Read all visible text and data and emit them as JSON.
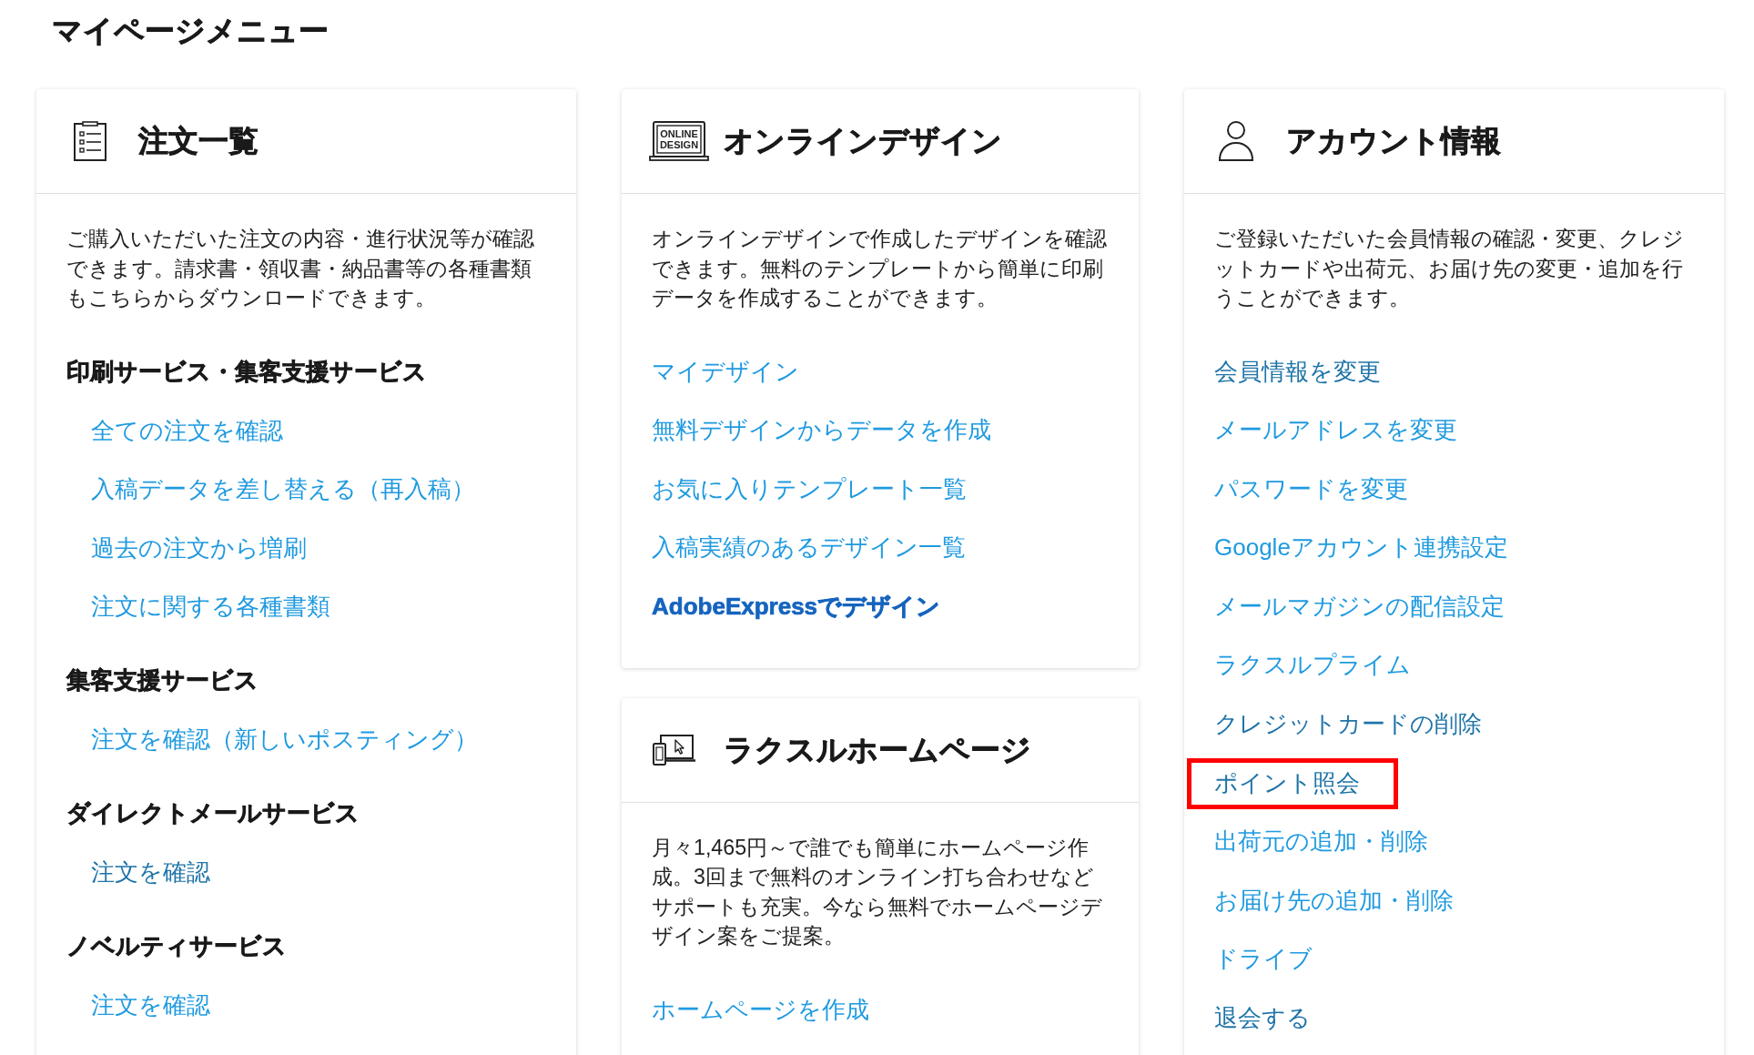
{
  "page_title": "マイページメニュー",
  "columns": [
    {
      "cards": [
        {
          "kind": "orders",
          "title": "注文一覧",
          "description": "ご購入いただいた注文の内容・進行状況等が確認できます。請求書・領収書・納品書等の各種書類もこちらからダウンロードできます。",
          "sections": [
            {
              "heading": "印刷サービス・集客支援サービス",
              "links": [
                {
                  "label": "全ての注文を確認",
                  "visited": false
                },
                {
                  "label": "入稿データを差し替える（再入稿）",
                  "visited": false
                },
                {
                  "label": "過去の注文から増刷",
                  "visited": false
                },
                {
                  "label": "注文に関する各種書類",
                  "visited": false
                }
              ]
            },
            {
              "heading": "集客支援サービス",
              "links": [
                {
                  "label": "注文を確認（新しいポスティング）",
                  "visited": false
                }
              ]
            },
            {
              "heading": "ダイレクトメールサービス",
              "links": [
                {
                  "label": "注文を確認",
                  "visited": true
                }
              ]
            },
            {
              "heading": "ノベルティサービス",
              "links": [
                {
                  "label": "注文を確認",
                  "visited": false
                }
              ]
            }
          ]
        }
      ]
    },
    {
      "cards": [
        {
          "kind": "design",
          "title": "オンラインデザイン",
          "icon_label": [
            "ONLINE",
            "DESIGN"
          ],
          "description": "オンラインデザインで作成したデザインを確認できます。無料のテンプレートから簡単に印刷データを作成することができます。",
          "links": [
            {
              "label": "マイデザイン",
              "kind": "link",
              "visited": false
            },
            {
              "label": "無料デザインからデータを作成",
              "kind": "link",
              "visited": false
            },
            {
              "label": "お気に入りテンプレート一覧",
              "kind": "link",
              "visited": false
            },
            {
              "label": "入稿実績のあるデザイン一覧",
              "kind": "link",
              "visited": false
            },
            {
              "label": "AdobeExpressでデザイン",
              "kind": "featured",
              "visited": false
            }
          ]
        },
        {
          "kind": "homepage",
          "title": "ラクスルホームページ",
          "description": "月々1,465円～で誰でも簡単にホームページ作成。3回まで無料のオンライン打ち合わせなどサポートも充実。今なら無料でホームページデザイン案をご提案。",
          "links": [
            {
              "label": "ホームページを作成",
              "visited": false
            }
          ]
        }
      ]
    },
    {
      "cards": [
        {
          "kind": "account",
          "title": "アカウント情報",
          "description": "ご登録いただいた会員情報の確認・変更、クレジットカードや出荷元、お届け先の変更・追加を行うことができます。",
          "links": [
            {
              "label": "会員情報を変更",
              "visited": true,
              "highlighted": false
            },
            {
              "label": "メールアドレスを変更",
              "visited": false,
              "highlighted": false
            },
            {
              "label": "パスワードを変更",
              "visited": false,
              "highlighted": false
            },
            {
              "label": "Googleアカウント連携設定",
              "visited": false,
              "highlighted": false
            },
            {
              "label": "メールマガジンの配信設定",
              "visited": false,
              "highlighted": false
            },
            {
              "label": "ラクスルプライム",
              "visited": false,
              "highlighted": false
            },
            {
              "label": "クレジットカードの削除",
              "visited": true,
              "highlighted": false
            },
            {
              "label": "ポイント照会",
              "visited": true,
              "highlighted": true
            },
            {
              "label": "出荷元の追加・削除",
              "visited": false,
              "highlighted": false
            },
            {
              "label": "お届け先の追加・削除",
              "visited": false,
              "highlighted": false
            },
            {
              "label": "ドライブ",
              "visited": false,
              "highlighted": false
            },
            {
              "label": "退会する",
              "visited": true,
              "highlighted": false
            }
          ]
        }
      ]
    }
  ]
}
